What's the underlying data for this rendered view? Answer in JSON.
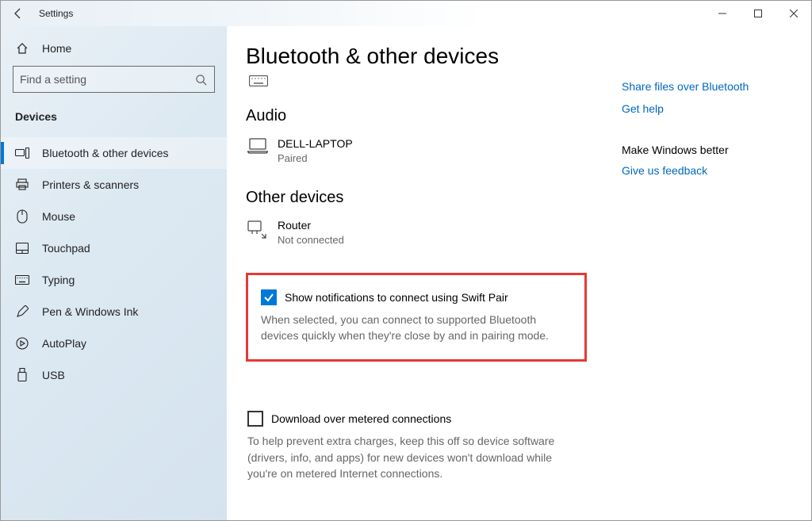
{
  "titlebar": {
    "title": "Settings"
  },
  "sidebar": {
    "home_label": "Home",
    "search_placeholder": "Find a setting",
    "category_label": "Devices",
    "items": [
      {
        "label": "Bluetooth & other devices"
      },
      {
        "label": "Printers & scanners"
      },
      {
        "label": "Mouse"
      },
      {
        "label": "Touchpad"
      },
      {
        "label": "Typing"
      },
      {
        "label": "Pen & Windows Ink"
      },
      {
        "label": "AutoPlay"
      },
      {
        "label": "USB"
      }
    ]
  },
  "page": {
    "title": "Bluetooth & other devices",
    "audio_heading": "Audio",
    "audio_device_name": "DELL-LAPTOP",
    "audio_device_status": "Paired",
    "other_heading": "Other devices",
    "other_device_name": "Router",
    "other_device_status": "Not connected",
    "swift_pair_label": "Show notifications to connect using Swift Pair",
    "swift_pair_desc": "When selected, you can connect to supported Bluetooth devices quickly when they're close by and in pairing mode.",
    "metered_label": "Download over metered connections",
    "metered_desc": "To help prevent extra charges, keep this off so device software (drivers, info, and apps) for new devices won't download while you're on metered Internet connections."
  },
  "right": {
    "link_share": "Share files over Bluetooth",
    "link_help": "Get help",
    "feedback_heading": "Make Windows better",
    "link_feedback": "Give us feedback"
  }
}
